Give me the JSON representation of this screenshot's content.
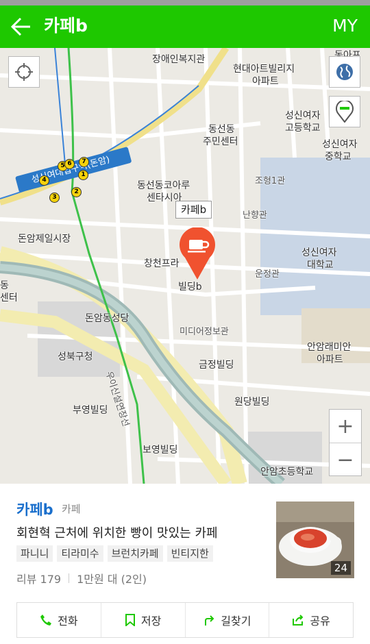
{
  "header": {
    "title": "카페b",
    "my_label": "MY"
  },
  "map": {
    "labels": {
      "jangaein": "장애인복지관",
      "hyundai1": "현대아트빌리지",
      "hyundai2": "아파트",
      "dongam_apt": "동아프",
      "sungshin_high1": "성신여자",
      "sungshin_high2": "고등학교",
      "sungshin_mid1": "성신여자",
      "sungshin_mid2": "중학교",
      "dongseon_center1": "동선동",
      "dongseon_center2": "주민센터",
      "koaru1": "동선동코아루",
      "koaru2": "센타시아",
      "joheung": "조형1관",
      "nanhyang": "난향관",
      "sungshin_univ1": "성신여자",
      "sungshin_univ2": "대학교",
      "unjeong": "운정관",
      "donam_market": "돈암제일시장",
      "changcheon": "창천프라",
      "building_b": "빌딩b",
      "dong_left1": "동",
      "dong_left2": "센터",
      "donam_church": "돈암동성당",
      "media": "미디어정보관",
      "seongbuk": "성북구청",
      "geumjeong": "금정빌딩",
      "anam_apt1": "안암래미안",
      "anam_apt2": "아파트",
      "wondang": "원당빌딩",
      "buyeong": "부영빌딩",
      "stream": "우이신설연장선",
      "boyeong": "보영빌딩",
      "anam_school": "안암초등학교"
    },
    "station": "성신여대입구역(돈암)",
    "exits": [
      "4",
      "5",
      "6",
      "7",
      "1",
      "2",
      "3"
    ],
    "callout": "카페b",
    "zoom_in": "+",
    "zoom_out": "−"
  },
  "place": {
    "name": "카페b",
    "category": "카페",
    "description": "회현혁 근처에 위치한 빵이 맛있는 카페",
    "tags": [
      "파니니",
      "티라미수",
      "브런치카페",
      "빈티지한"
    ],
    "reviews": "리뷰 179",
    "price": "1만원 대 (2인)",
    "photo_count": "24"
  },
  "actions": {
    "call": "전화",
    "save": "저장",
    "directions": "길찾기",
    "share": "공유"
  },
  "colors": {
    "brand": "#1ec800",
    "name_blue": "#1a6fcc",
    "marker": "#f0522f"
  }
}
